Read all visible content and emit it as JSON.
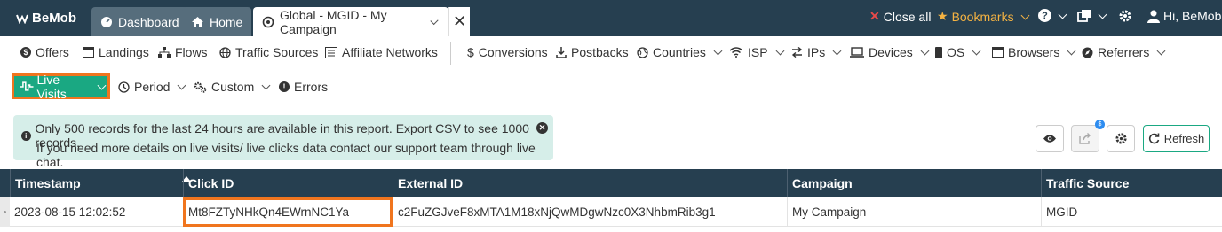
{
  "topbar": {
    "logo": "BeMob",
    "tabs": [
      {
        "label": "Dashboard",
        "icon": "dashboard-icon"
      },
      {
        "label": "Home",
        "icon": "home-icon"
      },
      {
        "label": "Global - MGID - My Campaign",
        "icon": "campaign-icon"
      }
    ],
    "close_all": "Close all",
    "bookmarks": "Bookmarks",
    "greeting": "Hi, BeMob"
  },
  "nav": {
    "items": [
      {
        "label": "Offers",
        "icon": "dollar-circle-icon",
        "dropdown": false
      },
      {
        "label": "Landings",
        "icon": "landing-page-icon",
        "dropdown": false
      },
      {
        "label": "Flows",
        "icon": "sitemap-icon",
        "dropdown": false
      },
      {
        "label": "Traffic Sources",
        "icon": "globe-icon",
        "dropdown": false
      },
      {
        "label": "Affiliate Networks",
        "icon": "network-icon",
        "dropdown": false
      },
      {
        "label": "Conversions",
        "icon": "dollar-icon",
        "dropdown": false
      },
      {
        "label": "Postbacks",
        "icon": "download-icon",
        "dropdown": false
      },
      {
        "label": "Countries",
        "icon": "globe-icon",
        "dropdown": true
      },
      {
        "label": "ISP",
        "icon": "wifi-icon",
        "dropdown": true
      },
      {
        "label": "IPs",
        "icon": "exchange-icon",
        "dropdown": true
      },
      {
        "label": "Devices",
        "icon": "laptop-icon",
        "dropdown": true
      },
      {
        "label": "OS",
        "icon": "mobile-icon",
        "dropdown": true
      },
      {
        "label": "Browsers",
        "icon": "browser-icon",
        "dropdown": true
      },
      {
        "label": "Referrers",
        "icon": "compass-icon",
        "dropdown": true
      }
    ]
  },
  "row2": {
    "live_visits": "Live Visits",
    "period": "Period",
    "custom": "Custom",
    "errors": "Errors"
  },
  "notice": {
    "line1": "Only 500 records for the last 24 hours are available in this report. Export CSV to see 1000 records.",
    "line2": "If you need more details on live visits/ live clicks data contact our support team through live chat."
  },
  "toolbar": {
    "export_badge": "$",
    "refresh": "Refresh"
  },
  "table": {
    "columns": [
      "Timestamp",
      "Click ID",
      "External ID",
      "Campaign",
      "Traffic Source"
    ],
    "rows": [
      [
        "2023-08-15 12:02:52",
        "Mt8FZTyNHkQn4EWrnNC1Ya",
        "c2FuZGJveF8xMTA1M18xNjQwMDgwNzc0X3NhbmRib3g1",
        "My Campaign",
        "MGID"
      ]
    ]
  }
}
